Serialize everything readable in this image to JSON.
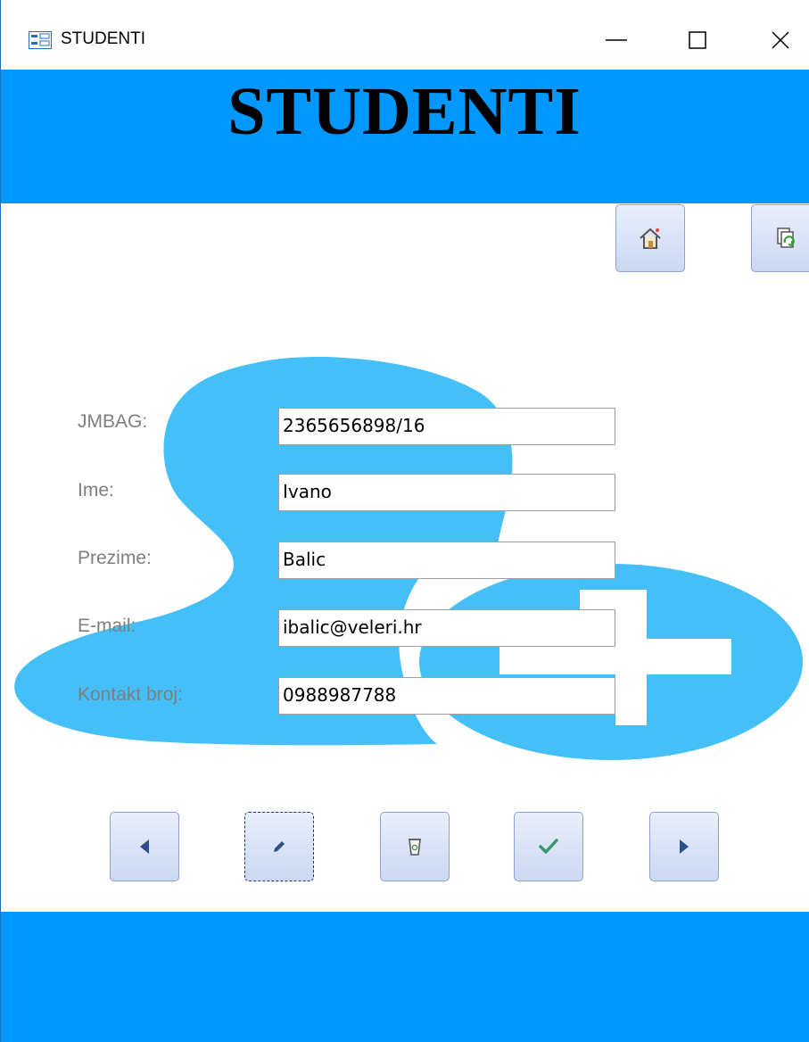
{
  "window": {
    "title": "STUDENTI",
    "icon": "form-icon",
    "controls": {
      "minimize": "minimize-icon",
      "maximize": "maximize-icon",
      "close": "close-icon"
    }
  },
  "header": {
    "title": "STUDENTI"
  },
  "toolbar": {
    "home_icon": "home-icon",
    "refresh_icon": "refresh-icon"
  },
  "form": {
    "fields": [
      {
        "label": "JMBAG:",
        "value": "2365656898/16"
      },
      {
        "label": "Ime:",
        "value": "Ivano"
      },
      {
        "label": "Prezime:",
        "value": "Balic"
      },
      {
        "label": "E-mail:",
        "value": "ibalic@veleri.hr"
      },
      {
        "label": "Kontakt broj:",
        "value": "0988987788"
      }
    ]
  },
  "nav_buttons": [
    "previous-icon",
    "edit-icon",
    "delete-icon",
    "save-icon",
    "next-icon"
  ],
  "colors": {
    "header": "#0098fe",
    "footer": "#0098fe",
    "background_art": "#45bff8",
    "label": "#7f7f7f",
    "check": "#3a9a6a"
  }
}
